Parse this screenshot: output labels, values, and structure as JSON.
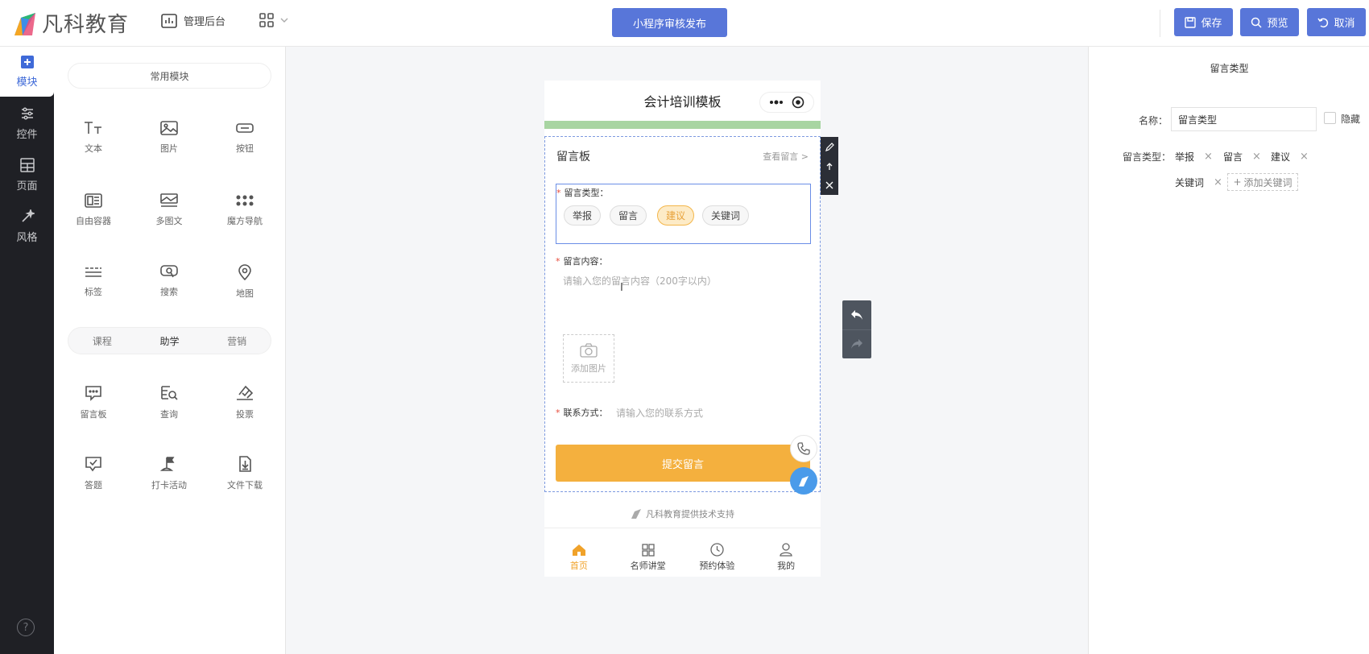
{
  "brand": {
    "name": "凡科教育",
    "colors": {
      "primary": "#5876d9",
      "rail": "#1f2025",
      "accent_orange": "#f4b03e",
      "selected_chip": "#fdebc7"
    }
  },
  "topbar": {
    "admin_label": "管理后台",
    "publish_label": "小程序审核发布",
    "save_label": "保存",
    "preview_label": "预览",
    "cancel_label": "取消"
  },
  "rail": {
    "items": [
      {
        "label": "模块",
        "icon": "plus-square-icon",
        "active": true
      },
      {
        "label": "控件",
        "icon": "sliders-icon"
      },
      {
        "label": "页面",
        "icon": "layout-icon"
      },
      {
        "label": "风格",
        "icon": "magic-wand-icon"
      }
    ],
    "help": "?"
  },
  "modules": {
    "common_title": "常用模块",
    "common": [
      "文本",
      "图片",
      "按钮",
      "自由容器",
      "多图文",
      "魔方导航",
      "标签",
      "搜索",
      "地图"
    ],
    "tabs": [
      "课程",
      "助学",
      "营销"
    ],
    "active_tab": "助学",
    "study": [
      "留言板",
      "查询",
      "投票",
      "答题",
      "打卡活动",
      "文件下载"
    ]
  },
  "phone": {
    "title": "会计培训模板",
    "board": {
      "title": "留言板",
      "view_link": "查看留言 >",
      "type_label": "留言类型：",
      "chips": [
        "举报",
        "留言",
        "建议",
        "关键词"
      ],
      "selected_chip": "建议",
      "content_label": "留言内容：",
      "content_placeholder": "请输入您的留言内容（200字以内）",
      "add_image": "添加图片",
      "contact_label": "联系方式：",
      "contact_placeholder": "请输入您的联系方式",
      "submit": "提交留言"
    },
    "support_text": "凡科教育提供技术支持",
    "nav": [
      "首页",
      "名师讲堂",
      "预约体验",
      "我的"
    ],
    "active_nav": "首页"
  },
  "props": {
    "title": "留言类型",
    "name_label": "名称：",
    "name_value": "留言类型",
    "hide_label": "隐藏",
    "types_label": "留言类型：",
    "types": [
      "举报",
      "留言",
      "建议",
      "关键词"
    ],
    "add_keyword": "添加关键词"
  }
}
